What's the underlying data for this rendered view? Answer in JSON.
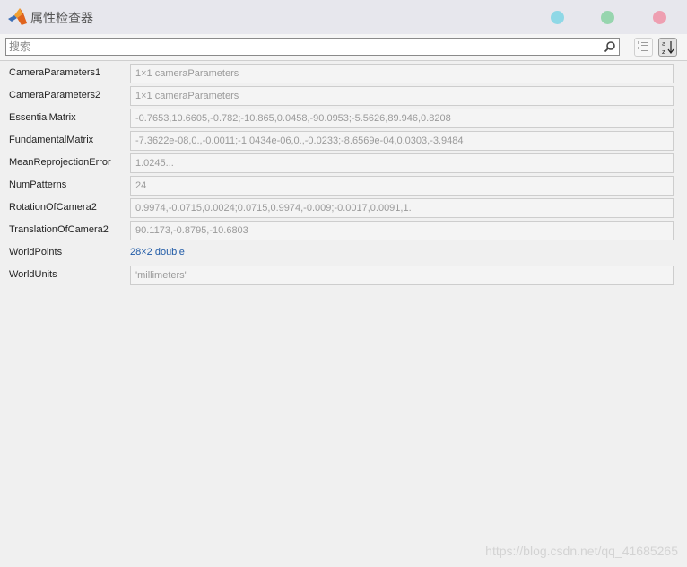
{
  "window": {
    "title": "属性检查器",
    "buttons": [
      {
        "name": "minimize",
        "color": "#8fd8e6"
      },
      {
        "name": "maximize",
        "color": "#97d5ae"
      },
      {
        "name": "close",
        "color": "#ee9fb1"
      }
    ]
  },
  "toolbar": {
    "search_placeholder": "搜索",
    "search_icon": "magnifier-icon",
    "grouped_view_icon": "grouped-list-icon",
    "alpha_view_icon": "sort-az-icon"
  },
  "properties": [
    {
      "name": "CameraParameters1",
      "value": "1×1 cameraParameters",
      "kind": "field"
    },
    {
      "name": "CameraParameters2",
      "value": "1×1 cameraParameters",
      "kind": "field"
    },
    {
      "name": "EssentialMatrix",
      "value": "-0.7653,10.6605,-0.782;-10.865,0.0458,-90.0953;-5.5626,89.946,0.8208",
      "kind": "field"
    },
    {
      "name": "FundamentalMatrix",
      "value": "-7.3622e-08,0.,-0.0011;-1.0434e-06,0.,-0.0233;-8.6569e-04,0.0303,-3.9484",
      "kind": "field"
    },
    {
      "name": "MeanReprojectionError",
      "value": "1.0245...",
      "kind": "field"
    },
    {
      "name": "NumPatterns",
      "value": "24",
      "kind": "field"
    },
    {
      "name": "RotationOfCamera2",
      "value": "0.9974,-0.0715,0.0024;0.0715,0.9974,-0.009;-0.0017,0.0091,1.",
      "kind": "field"
    },
    {
      "name": "TranslationOfCamera2",
      "value": "90.1173,-0.8795,-10.6803",
      "kind": "field"
    },
    {
      "name": "WorldPoints",
      "value": "28×2 double",
      "kind": "link"
    },
    {
      "name": "WorldUnits",
      "value": "'millimeters'",
      "kind": "field"
    }
  ],
  "colors": {
    "link": "#1f5aa6",
    "field_text": "#9a9a9a",
    "titlebar": "#e7e7ed"
  },
  "watermark": "https://blog.csdn.net/qq_41685265"
}
